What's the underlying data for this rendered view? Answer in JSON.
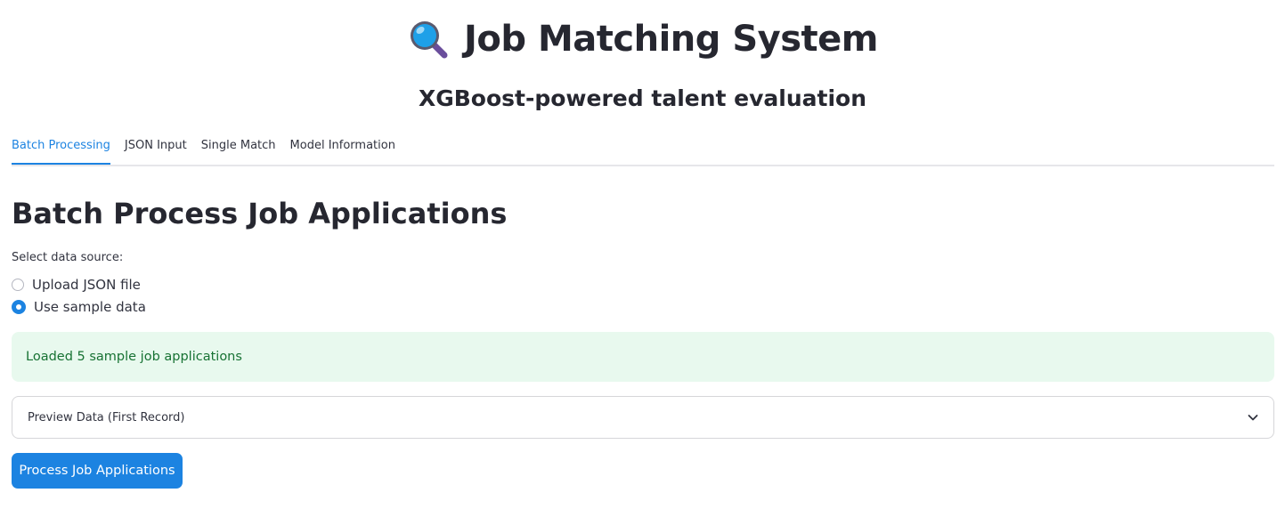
{
  "header": {
    "title": "Job Matching System",
    "title_icon": "magnifying-glass-icon",
    "subtitle": "XGBoost-powered talent evaluation"
  },
  "tabs": [
    {
      "label": "Batch Processing",
      "active": true
    },
    {
      "label": "JSON Input",
      "active": false
    },
    {
      "label": "Single Match",
      "active": false
    },
    {
      "label": "Model Information",
      "active": false
    }
  ],
  "main": {
    "section_title": "Batch Process Job Applications",
    "data_source": {
      "label": "Select data source:",
      "options": [
        {
          "label": "Upload JSON file",
          "selected": false
        },
        {
          "label": "Use sample data",
          "selected": true
        }
      ]
    },
    "success_message": "Loaded 5 sample job applications",
    "expander": {
      "label": "Preview Data (First Record)",
      "icon": "chevron-down-icon"
    },
    "process_button": "Process Job Applications"
  },
  "colors": {
    "accent": "#1c83e1",
    "success_bg": "#e8f9ee",
    "success_text": "#177233"
  }
}
